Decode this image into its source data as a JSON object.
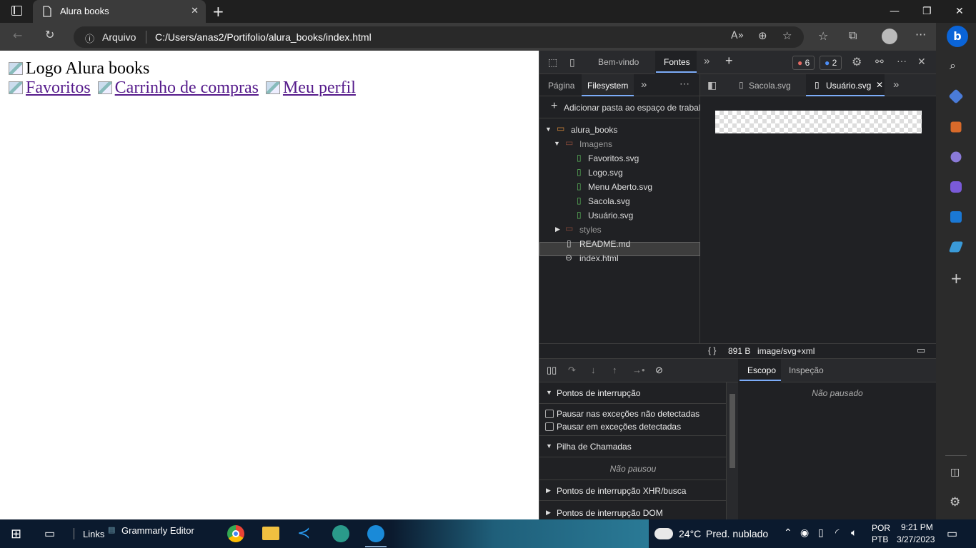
{
  "browser": {
    "tab_title": "Alura books",
    "address": {
      "origin_label": "Arquivo",
      "url": "C:/Users/anas2/Portifolio/alura_books/index.html"
    }
  },
  "page": {
    "logo_alt": "Logo Alura books",
    "links": [
      {
        "label": "Favoritos"
      },
      {
        "label": "Carrinho de compras"
      },
      {
        "label": "Meu perfil"
      }
    ]
  },
  "devtools": {
    "top_tabs": [
      "Bem-vindo",
      "Fontes"
    ],
    "errors_count": "6",
    "issues_count": "2",
    "left_tabs": [
      "Página",
      "Filesystem"
    ],
    "add_folder_label": "Adicionar pasta ao espaço de trabal",
    "tree": {
      "root": "alura_books",
      "imagens_folder": "Imagens",
      "files_in_imagens": [
        "Favoritos.svg",
        "Logo.svg",
        "Menu Aberto.svg",
        "Sacola.svg",
        "Usuário.svg"
      ],
      "styles_folder": "styles",
      "readme": "README.md",
      "index": "index.html"
    },
    "editor_tabs": [
      "Sacola.svg",
      "Usuário.svg"
    ],
    "status": {
      "braces": "{ }",
      "size": "891 B",
      "mime": "image/svg+xml"
    },
    "sections": {
      "breakpoints": "Pontos de interrupção",
      "pause_uncaught": "Pausar nas exceções não detectadas",
      "pause_caught": "Pausar em exceções detectadas",
      "call_stack": "Pilha de Chamadas",
      "not_paused_left": "Não pausou",
      "xhr_breakpoints": "Pontos de interrupção XHR/busca",
      "dom_breakpoints": "Pontos de interrupção DOM"
    },
    "scope_tabs": [
      "Escopo",
      "Inspeção"
    ],
    "not_paused_right": "Não pausado"
  },
  "taskbar": {
    "links_label": "Links",
    "grammarly": "Grammarly Editor",
    "temperature": "24°C",
    "weather": "Pred. nublado",
    "lang_top": "POR",
    "lang_bottom": "PTB",
    "time": "9:21 PM",
    "date": "3/27/2023"
  },
  "colors": {
    "link": "#551a8b",
    "devtools_accent": "#7cacf8",
    "edge_blue": "#0a64d8"
  }
}
